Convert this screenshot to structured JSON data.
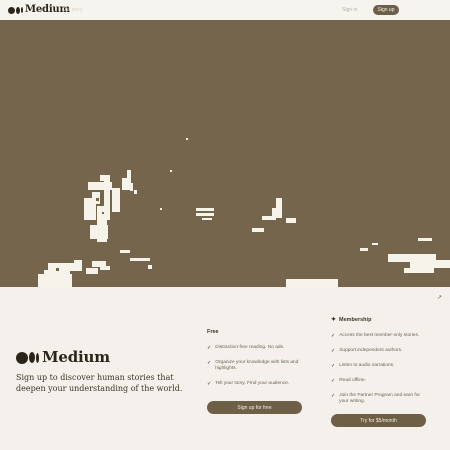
{
  "header": {
    "logo_text": "Medium",
    "nav_link": "Our story",
    "signin_link": "Sign in",
    "signup_button": "Sign up"
  },
  "hero": {
    "image_name": "night-street-photo"
  },
  "scroll_hint": "↗",
  "brand": {
    "logo_text": "Medium",
    "tagline": "Sign up to discover human stories that deepen your understanding of the world."
  },
  "plans": {
    "free": {
      "title": "Free",
      "features": [
        "Distraction-free reading. No ads.",
        "Organize your knowledge with lists and highlights.",
        "Tell your story. Find your audience."
      ],
      "button": "Sign up for free"
    },
    "membership": {
      "title": "Membership",
      "features": [
        "Access the best member-only stories.",
        "Support independent authors.",
        "Listen to audio narrations.",
        "Read offline.",
        "Join the Partner Program and earn for your writing."
      ],
      "button": "Try for $5/month"
    }
  },
  "colors": {
    "accent": "#6e5f47",
    "hero_bg": "#74654c",
    "page_bg": "#f4f1ec"
  }
}
